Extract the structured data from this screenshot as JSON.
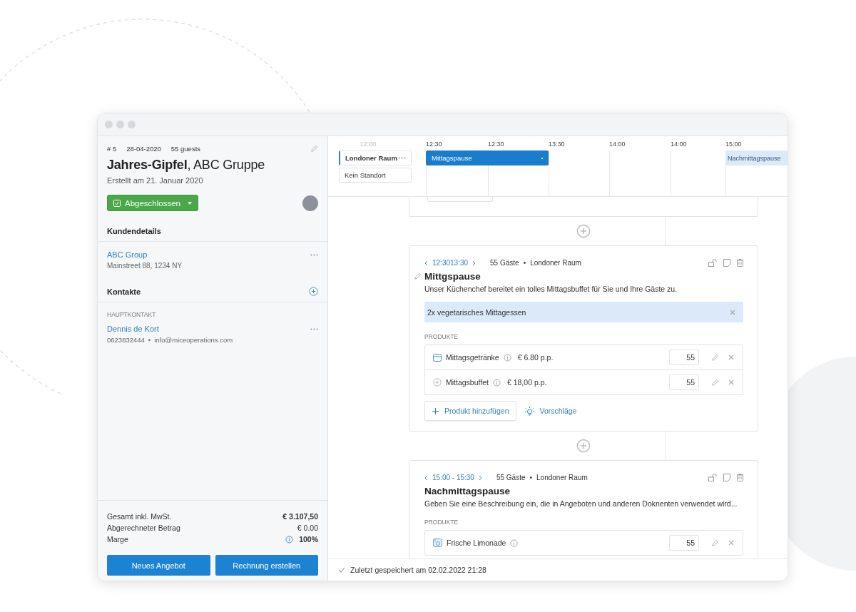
{
  "offer": {
    "number": "# 5",
    "date": "28-04-2020",
    "guests": "55 guests",
    "title": "**Jahres-Gipfel**, ABC Gruppe",
    "created": "Erstellt am 21. Januar 2020",
    "status": "Abgeschlossen"
  },
  "customer": {
    "heading": "Kundendetails",
    "name": "ABC Group",
    "address": "Mainstreet 88, 1234 NY"
  },
  "contacts": {
    "heading": "Kontakte",
    "label": "HAUPTKONTAKT",
    "name": "Dennis de Kort",
    "phone": "0623832444",
    "separator": "•",
    "email": "info@miceoperations.com"
  },
  "totals": [
    {
      "label": "Gesamt inkl. MwSt.",
      "value": "€ 3.107,50",
      "bold": true,
      "info": false
    },
    {
      "label": "Abgerechneter Betrag",
      "value": "€ 0.00",
      "bold": false,
      "info": false
    },
    {
      "label": "Marge",
      "value": "100%",
      "bold": true,
      "info": true
    }
  ],
  "actions": [
    "Neues Angebot",
    "Rechnung erstellen"
  ],
  "timeline": {
    "times": [
      {
        "label": "12:00",
        "dimmed": true
      },
      {
        "label": "12:30",
        "dimmed": false
      },
      {
        "label": "12:30",
        "dimmed": false
      },
      {
        "label": "13:30",
        "dimmed": false
      },
      {
        "label": "14:00",
        "dimmed": false
      },
      {
        "label": "14:00",
        "dimmed": false
      },
      {
        "label": "15:00",
        "dimmed": false
      }
    ],
    "rooms": [
      {
        "label": "Londoner Raum",
        "selected": true
      },
      {
        "label": "Kein Standort",
        "selected": false
      }
    ],
    "events": [
      {
        "label": "Mittagspause",
        "selected": true
      },
      {
        "label": "Nachmittagspause",
        "selected": false
      }
    ]
  },
  "cards": [
    {
      "time": "12:3013:30",
      "guests": "55 Gäste",
      "separator": "•",
      "room": "Londoner Raum",
      "editing": true,
      "title": "Mittgspause",
      "description": "Unser Küchenchef bereitet ein tolles Mittagsbuffet für Sie und Ihre Gäste zu.",
      "note": "2x vegetarisches Mittagessen",
      "products_label": "PRODUKTE",
      "products": [
        {
          "kind": "drinks",
          "name": "Mittagsgetränke",
          "price": "€ 6.80 p.p.",
          "quantity": "55"
        },
        {
          "kind": "buffet",
          "name": "Mittagsbuffet",
          "price": "€ 18,00 p.p.",
          "quantity": "55"
        }
      ],
      "add_button": "Produkt hinzufügen",
      "suggestions": "Vorschläge"
    },
    {
      "time": "15:00 - 15:30",
      "guests": "55 Gäste",
      "separator": "•",
      "room": "Londoner Raum",
      "editing": false,
      "title": "Nachmittagspause",
      "description": "Geben Sie eine Beschreibung ein, die in Angeboten und anderen Doknenten verwendet wird...",
      "products_label": "PRODUKTE",
      "products": [
        {
          "kind": "lemonade",
          "name": "Frische Limonade",
          "quantity": "55"
        }
      ]
    }
  ],
  "save_status": "Zuletzt gespeichert am 02.02.2022 21:28"
}
